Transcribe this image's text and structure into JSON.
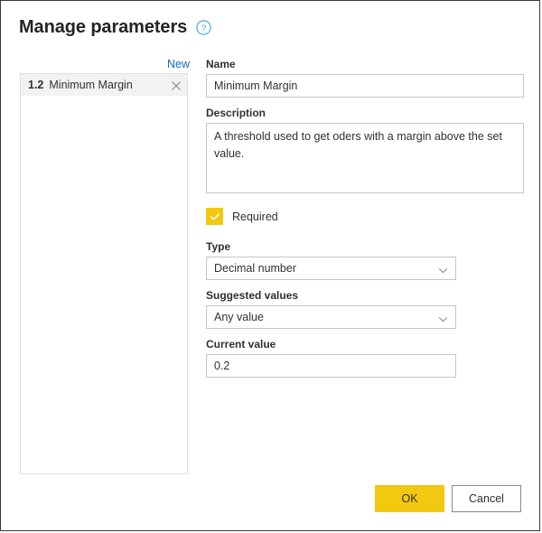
{
  "dialog": {
    "title": "Manage parameters",
    "help_icon": "help-circle-icon"
  },
  "left_panel": {
    "new_label": "New",
    "items": [
      {
        "type_badge": "1.2",
        "label": "Minimum Margin",
        "remove_icon": "close-icon",
        "selected": true
      }
    ]
  },
  "form": {
    "name": {
      "label": "Name",
      "value": "Minimum Margin",
      "placeholder": ""
    },
    "description": {
      "label": "Description",
      "value": "A threshold used to get oders with a margin above the set value.",
      "placeholder": ""
    },
    "required": {
      "label": "Required",
      "checked": true,
      "check_icon": "checkmark-icon"
    },
    "type": {
      "label": "Type",
      "value": "Decimal number",
      "chevron_icon": "chevron-down-icon"
    },
    "suggested_values": {
      "label": "Suggested values",
      "value": "Any value",
      "chevron_icon": "chevron-down-icon"
    },
    "current_value": {
      "label": "Current value",
      "value": "0.2",
      "placeholder": ""
    }
  },
  "footer": {
    "ok_label": "OK",
    "cancel_label": "Cancel"
  },
  "colors": {
    "accent_gold": "#f2c811",
    "link_blue": "#0f6cbd",
    "text_primary": "#323130",
    "border_grey": "#c8c6c4",
    "selected_row": "#f3f2f1"
  }
}
